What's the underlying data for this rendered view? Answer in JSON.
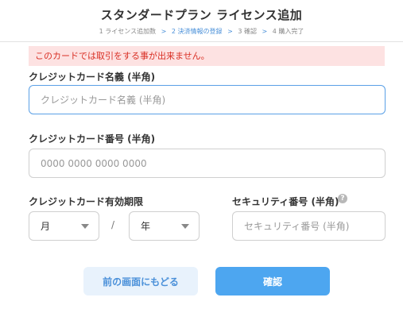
{
  "header": {
    "title": "スタンダードプラン ライセンス追加",
    "steps": [
      {
        "label": "1 ライセンス追加数"
      },
      {
        "label": "2 決済情報の登録"
      },
      {
        "label": "3 確認"
      },
      {
        "label": "4 購入完了"
      }
    ],
    "step_separator": ">",
    "active_step": 2,
    "active_color": "#4a90d9"
  },
  "error": {
    "message": "このカードでは取引をする事が出来ません。",
    "color": "#d93025",
    "background": "#fde2e2"
  },
  "form": {
    "card_name": {
      "label": "クレジットカード名義 (半角)",
      "placeholder": "クレジットカード名義 (半角)"
    },
    "card_number": {
      "label": "クレジットカード番号 (半角)",
      "placeholder": "0000 0000 0000 0000"
    },
    "expiry": {
      "label": "クレジットカード有効期限",
      "month_value": "月",
      "separator": "/",
      "year_value": "年"
    },
    "security": {
      "label": "セキュリティ番号 (半角)",
      "placeholder": "セキュリティ番号 (半角)",
      "help_icon": "question-circle-icon",
      "help_glyph": "?"
    }
  },
  "buttons": {
    "back_label": "前の画面にもどる",
    "confirm_label": "確認",
    "confirm_color": "#4da6f0"
  }
}
